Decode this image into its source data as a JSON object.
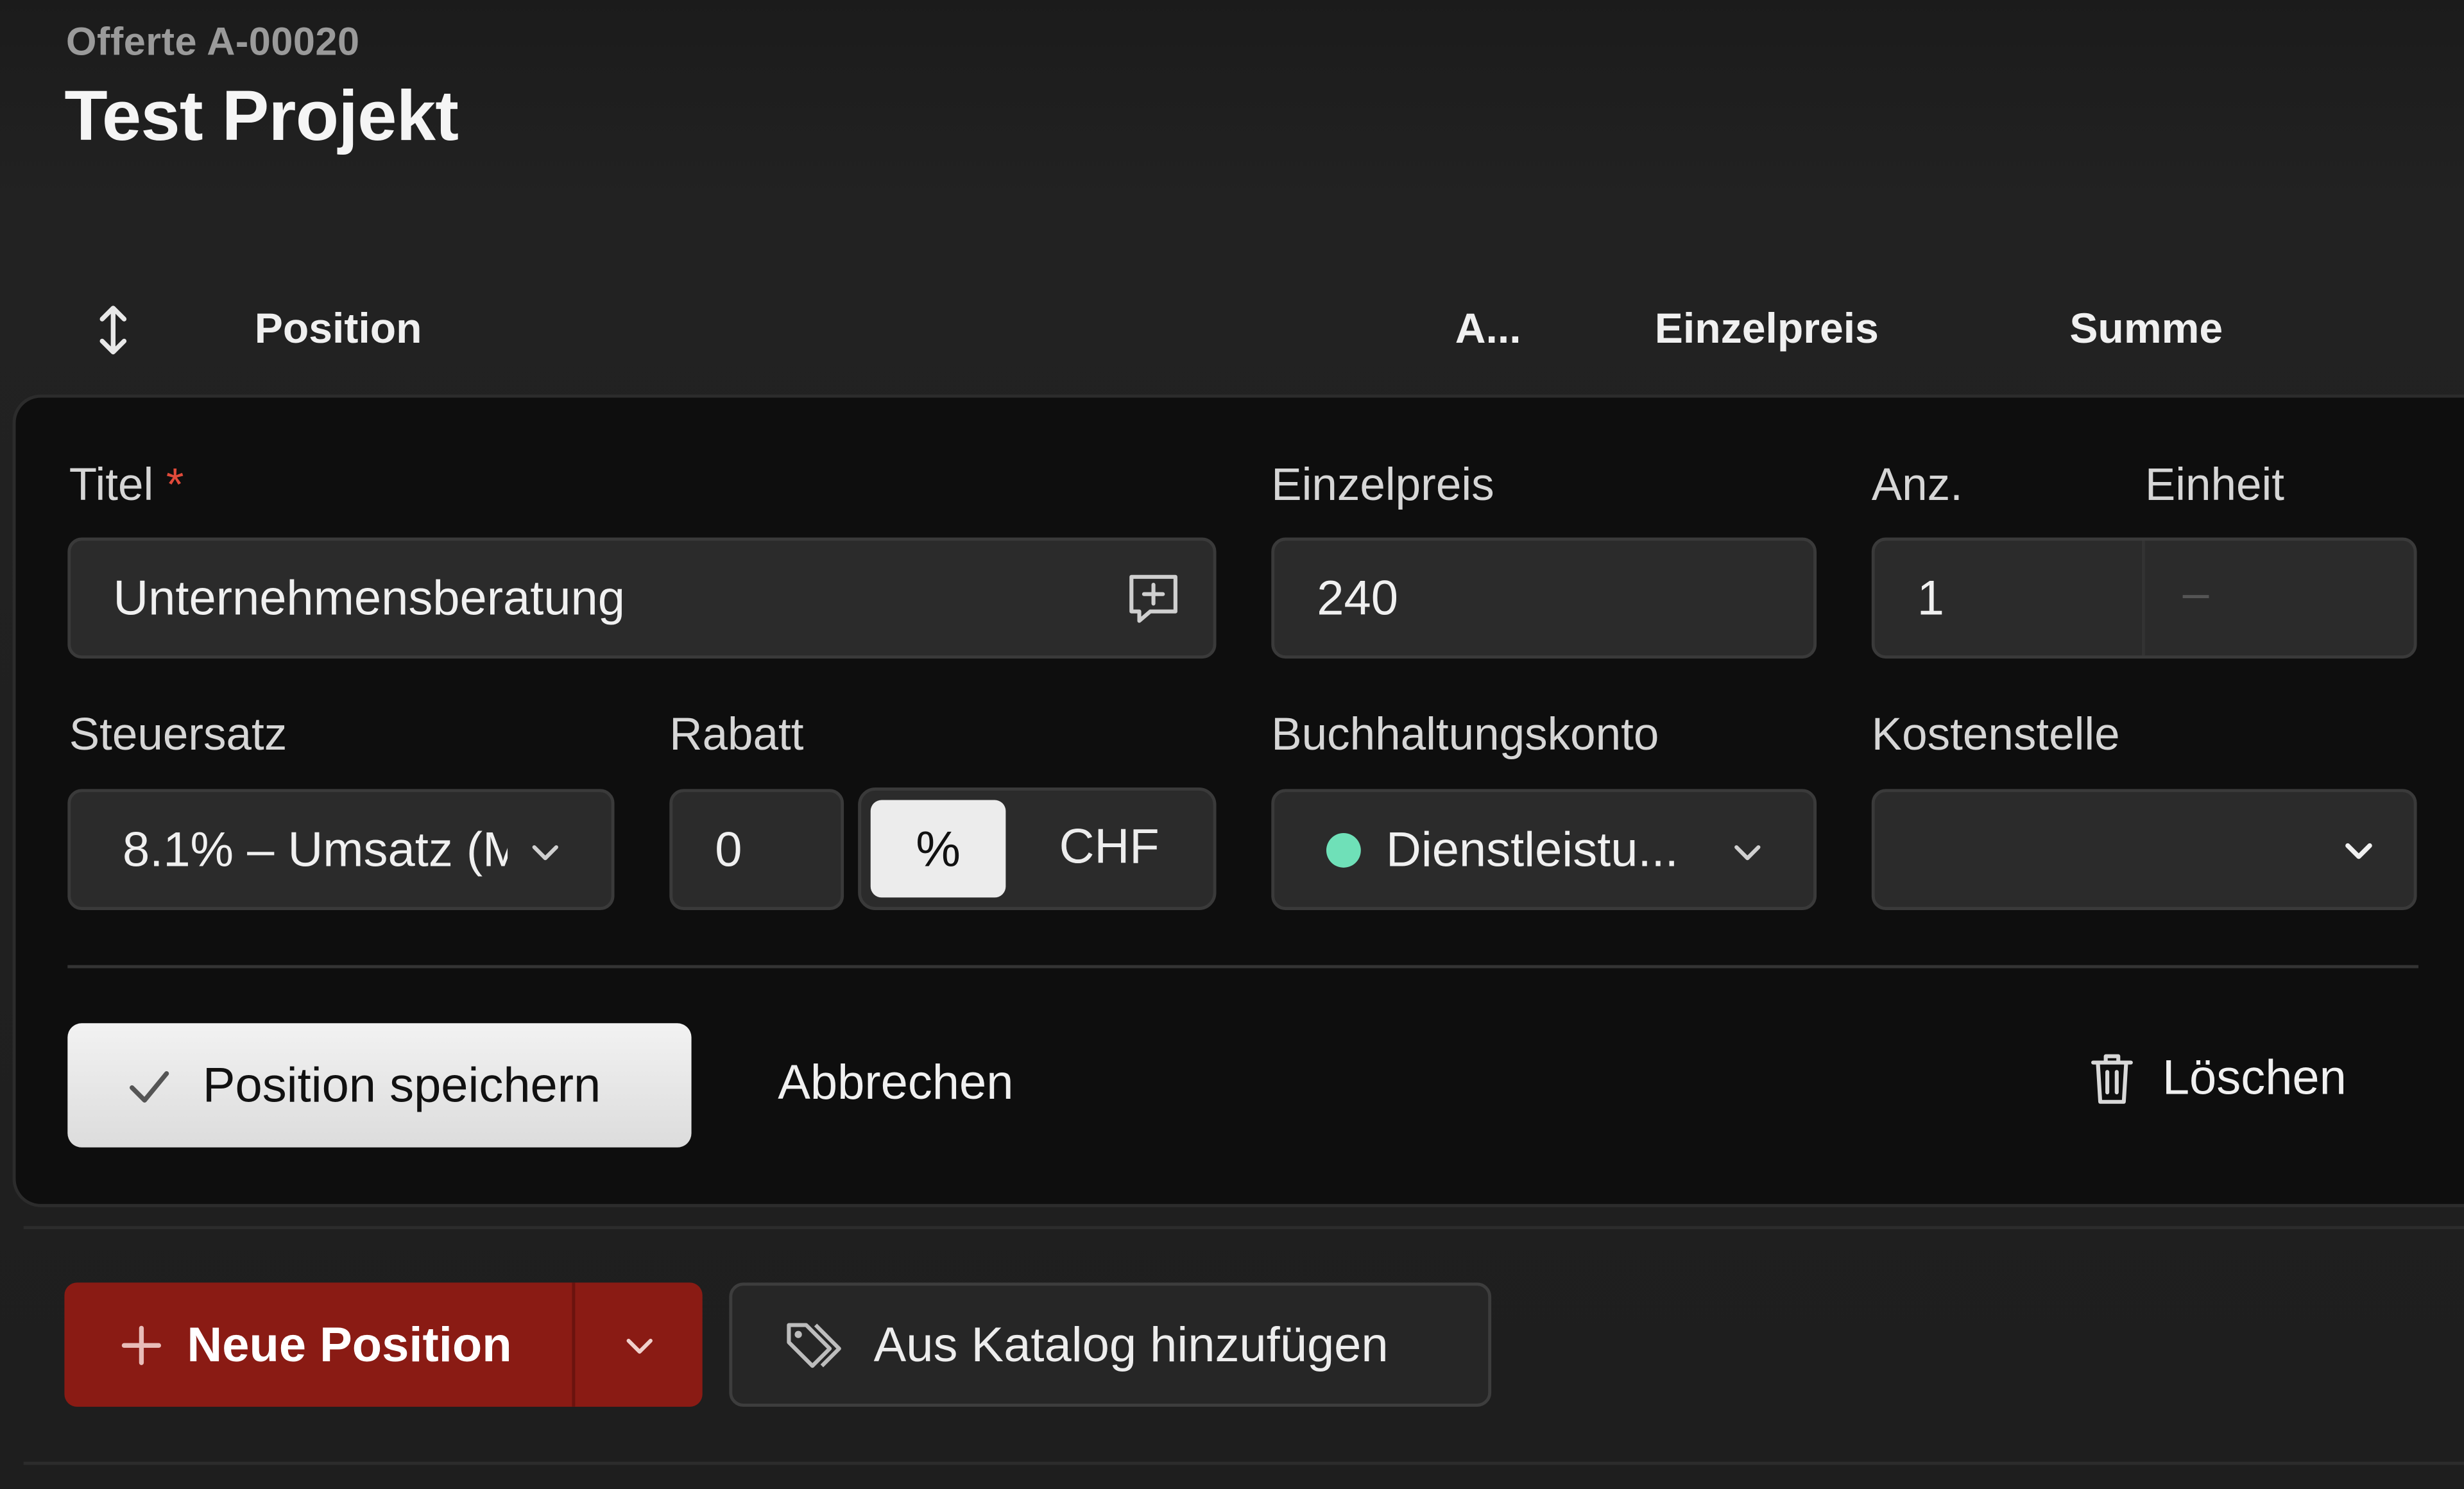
{
  "header": {
    "document_number": "Offerte A-00020",
    "project_title": "Test Projekt"
  },
  "table_header": {
    "position": "Position",
    "quantity_truncated": "A...",
    "unit_price": "Einzelpreis",
    "total": "Summe",
    "sort_icon": "vertical-arrows-icon"
  },
  "editor": {
    "title_label": "Titel",
    "required_marker": "*",
    "title_value": "Unternehmensberatung",
    "title_icon": "comment-plus-icon",
    "unit_price_label": "Einzelpreis",
    "unit_price_value": "240",
    "quantity_label": "Anz.",
    "quantity_value": "1",
    "unit_label": "Einheit",
    "unit_value": "–",
    "tax_label": "Steuersatz",
    "tax_value": "8.1% – Umsatz (M",
    "discount_label": "Rabatt",
    "discount_value": "0",
    "discount_modes": [
      "%",
      "CHF"
    ],
    "discount_active_mode": "%",
    "account_label": "Buchhaltungskonto",
    "account_value": "Dienstleistu...",
    "account_dot_color": "#6fe0b8",
    "cost_center_label": "Kostenstelle",
    "cost_center_value": "",
    "save_label": "Position speichern",
    "cancel_label": "Abbrechen",
    "delete_label": "Löschen"
  },
  "actions": {
    "new_position_label": "Neue Position",
    "catalog_label": "Aus Katalog hinzufügen",
    "accent_color": "#8a1b14"
  }
}
